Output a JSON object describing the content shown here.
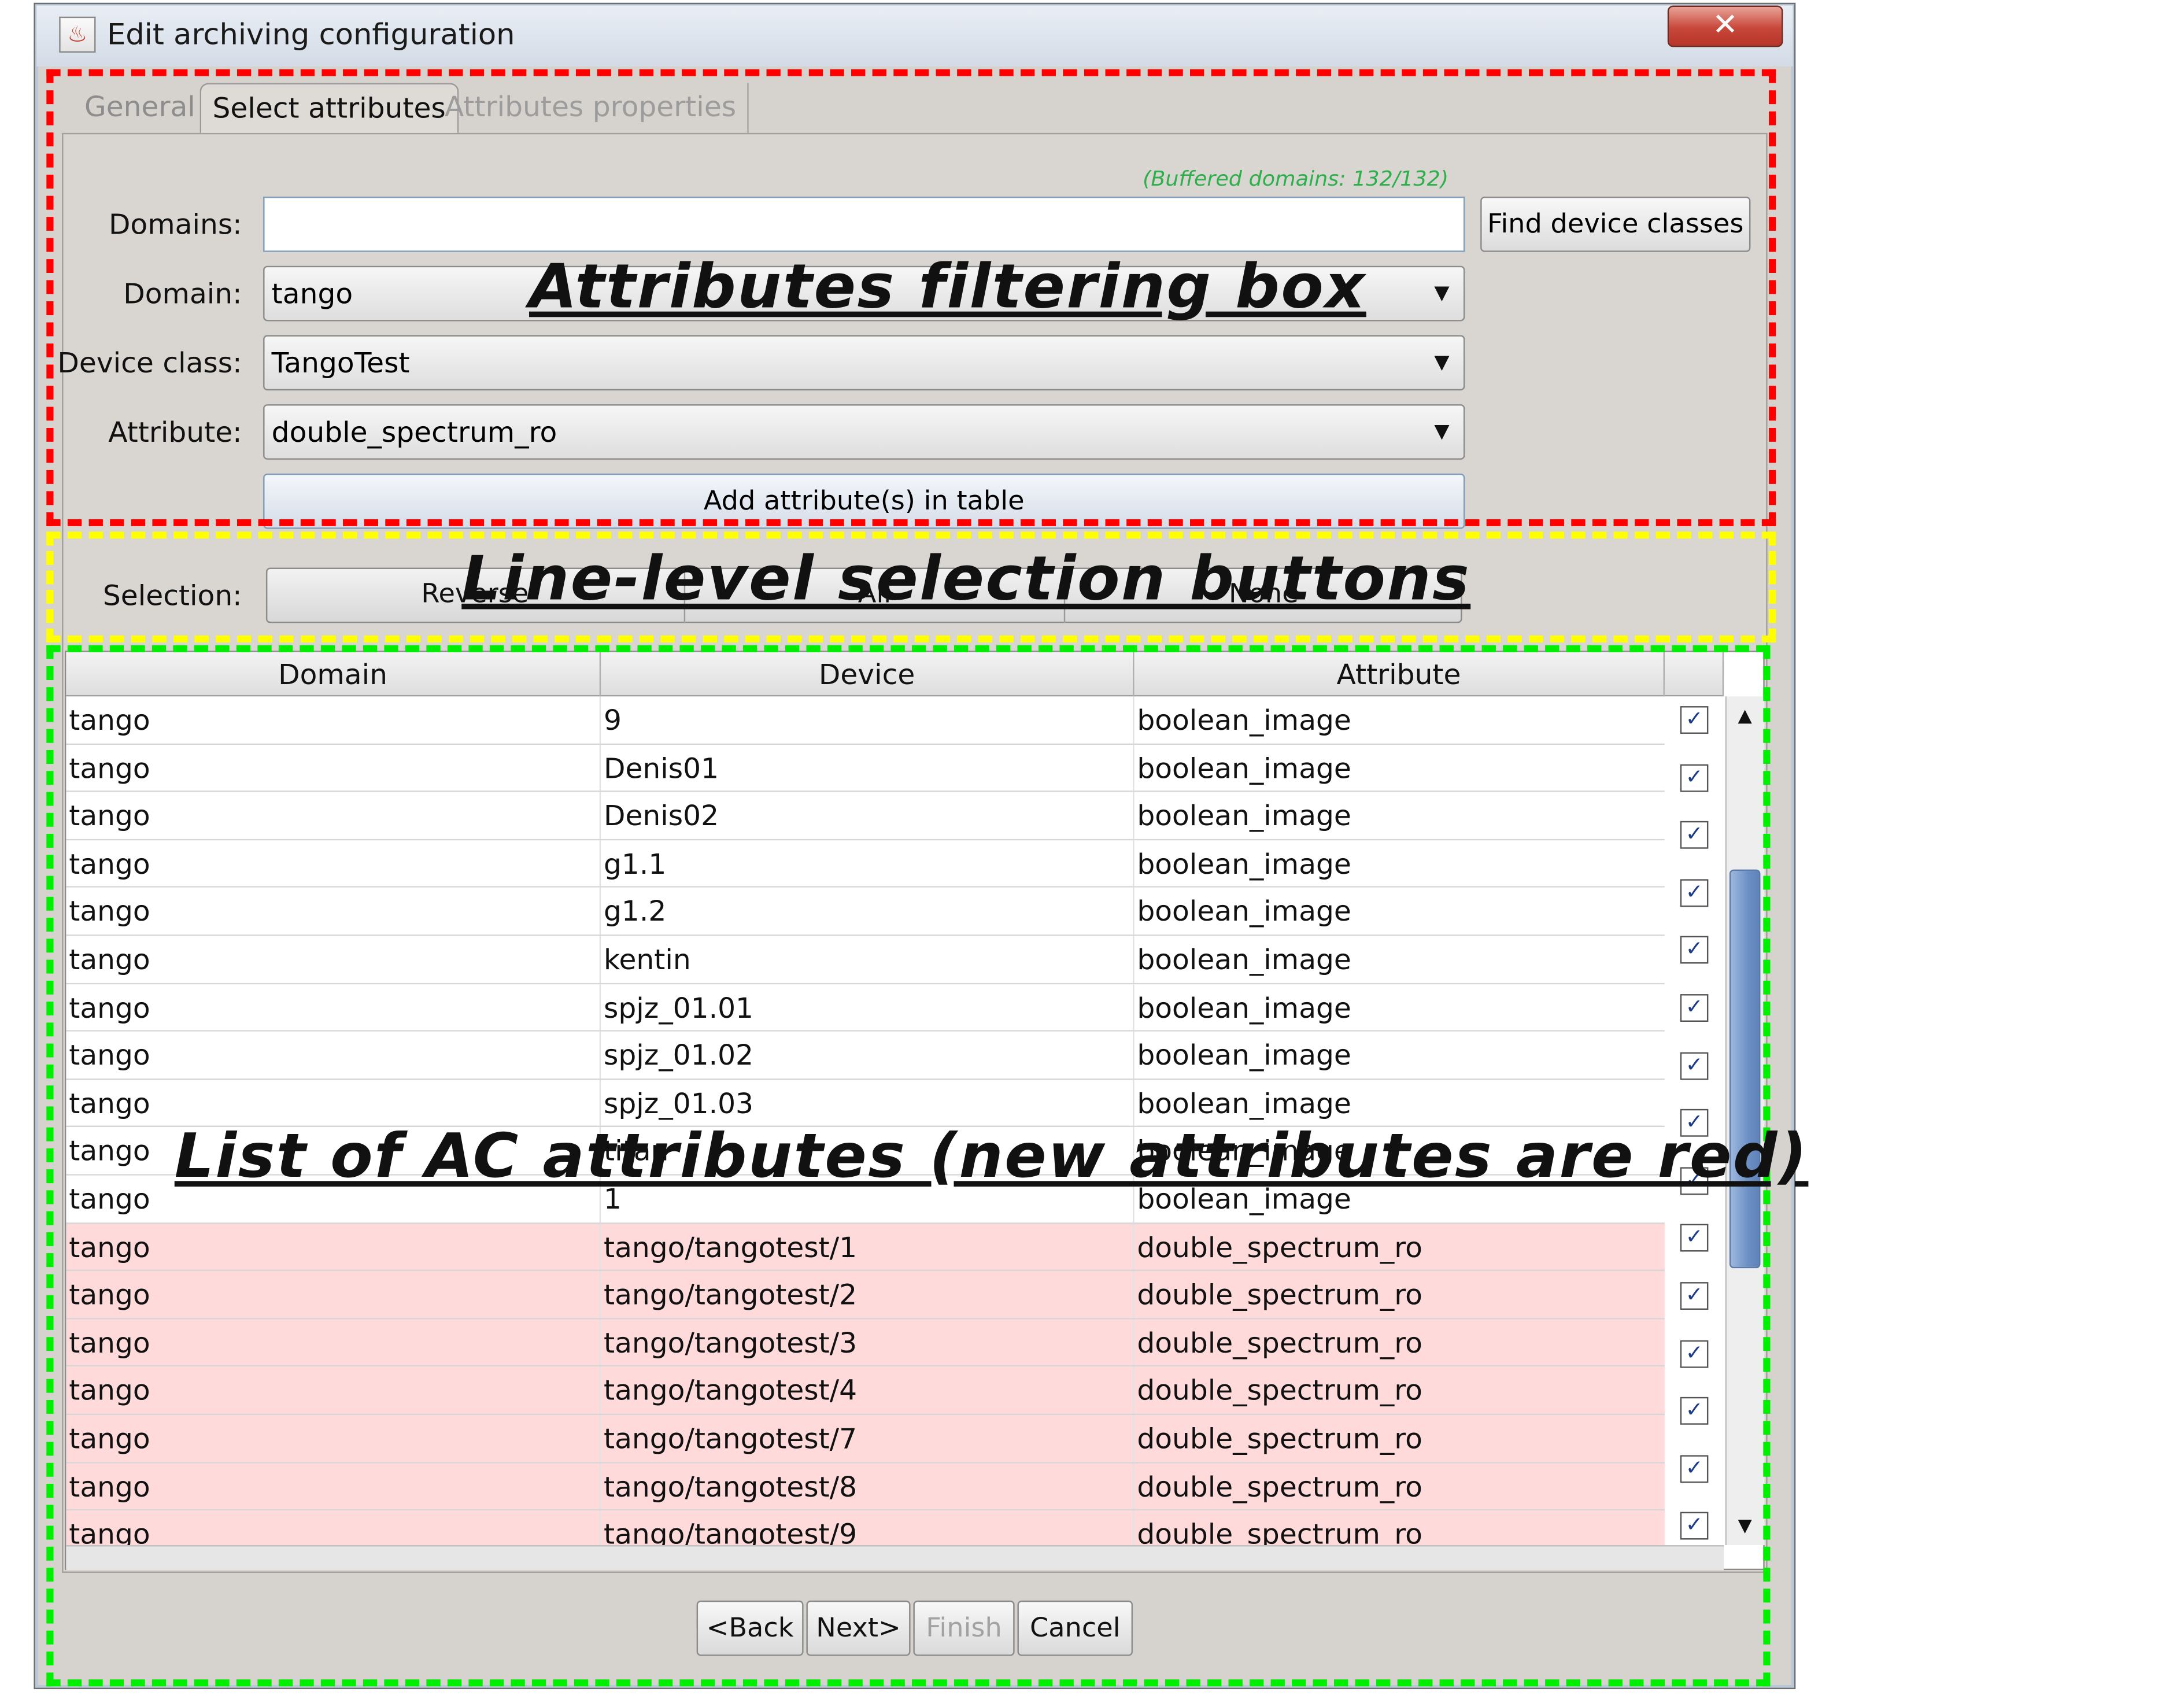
{
  "window": {
    "title": "Edit archiving configuration",
    "close_symbol": "✕"
  },
  "tabs": [
    {
      "label": "General",
      "state": "inactive"
    },
    {
      "label": "Select attributes",
      "state": "active"
    },
    {
      "label": "Attributes properties",
      "state": "disabled"
    }
  ],
  "filter": {
    "buffered_status": "(Buffered domains: 132/132)",
    "domains_label": "Domains:",
    "domains_value": "",
    "find_button": "Find device classes",
    "domain_label": "Domain:",
    "domain_value": "tango",
    "device_class_label": "Device class:",
    "device_class_value": "TangoTest",
    "attribute_label": "Attribute:",
    "attribute_value": "double_spectrum_ro",
    "add_button": "Add attribute(s) in table"
  },
  "selection": {
    "label": "Selection:",
    "reverse": "Reverse",
    "all": "All",
    "none": "None"
  },
  "table": {
    "columns": [
      "Domain",
      "Device",
      "Attribute"
    ],
    "rows": [
      {
        "domain": "tango",
        "device": "9",
        "attribute": "boolean_image",
        "checked": true,
        "is_new": false
      },
      {
        "domain": "tango",
        "device": "Denis01",
        "attribute": "boolean_image",
        "checked": true,
        "is_new": false
      },
      {
        "domain": "tango",
        "device": "Denis02",
        "attribute": "boolean_image",
        "checked": true,
        "is_new": false
      },
      {
        "domain": "tango",
        "device": "g1.1",
        "attribute": "boolean_image",
        "checked": true,
        "is_new": false
      },
      {
        "domain": "tango",
        "device": "g1.2",
        "attribute": "boolean_image",
        "checked": true,
        "is_new": false
      },
      {
        "domain": "tango",
        "device": "kentin",
        "attribute": "boolean_image",
        "checked": true,
        "is_new": false
      },
      {
        "domain": "tango",
        "device": "spjz_01.01",
        "attribute": "boolean_image",
        "checked": true,
        "is_new": false
      },
      {
        "domain": "tango",
        "device": "spjz_01.02",
        "attribute": "boolean_image",
        "checked": true,
        "is_new": false
      },
      {
        "domain": "tango",
        "device": "spjz_01.03",
        "attribute": "boolean_image",
        "checked": true,
        "is_new": false
      },
      {
        "domain": "tango",
        "device": "titan",
        "attribute": "boolean_image",
        "checked": true,
        "is_new": false
      },
      {
        "domain": "tango",
        "device": "1",
        "attribute": "boolean_image",
        "checked": true,
        "is_new": false
      },
      {
        "domain": "tango",
        "device": "tango/tangotest/1",
        "attribute": "double_spectrum_ro",
        "checked": true,
        "is_new": true
      },
      {
        "domain": "tango",
        "device": "tango/tangotest/2",
        "attribute": "double_spectrum_ro",
        "checked": true,
        "is_new": true
      },
      {
        "domain": "tango",
        "device": "tango/tangotest/3",
        "attribute": "double_spectrum_ro",
        "checked": true,
        "is_new": true
      },
      {
        "domain": "tango",
        "device": "tango/tangotest/4",
        "attribute": "double_spectrum_ro",
        "checked": true,
        "is_new": true
      },
      {
        "domain": "tango",
        "device": "tango/tangotest/7",
        "attribute": "double_spectrum_ro",
        "checked": true,
        "is_new": true
      },
      {
        "domain": "tango",
        "device": "tango/tangotest/8",
        "attribute": "double_spectrum_ro",
        "checked": true,
        "is_new": true
      },
      {
        "domain": "tango",
        "device": "tango/tangotest/9",
        "attribute": "double_spectrum_ro",
        "checked": true,
        "is_new": true
      }
    ],
    "scroll_up_symbol": "▲",
    "scroll_down_symbol": "▼"
  },
  "nav_buttons": {
    "back": "<Back",
    "next": "Next>",
    "finish": "Finish",
    "cancel": "Cancel"
  },
  "annotations": {
    "filter": "Attributes filtering box",
    "selection": "Line-level selection buttons",
    "list": "List of AC attributes (new attributes are red)"
  },
  "colors": {
    "new_row": "#ffdada",
    "buffered_text": "#2db04c",
    "filter_box": "#ff0000",
    "selection_box": "#ffff00",
    "list_box": "#00ee00"
  },
  "icons": {
    "app": "java-icon",
    "close": "close-icon",
    "dropdown": "chevron-down-icon",
    "checkbox": "checkmark-icon"
  }
}
